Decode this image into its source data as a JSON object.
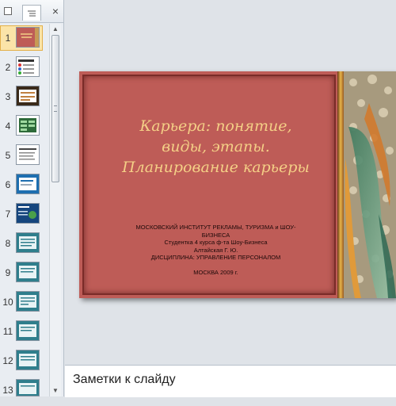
{
  "panel": {
    "tabs": [
      "outline-tab",
      "slides-tab"
    ],
    "close_icon": "×",
    "thumbnails": [
      {
        "num": "1",
        "selected": true
      },
      {
        "num": "2"
      },
      {
        "num": "3"
      },
      {
        "num": "4"
      },
      {
        "num": "5"
      },
      {
        "num": "6"
      },
      {
        "num": "7"
      },
      {
        "num": "8"
      },
      {
        "num": "9"
      },
      {
        "num": "10"
      },
      {
        "num": "11"
      },
      {
        "num": "12"
      },
      {
        "num": "13"
      }
    ]
  },
  "slide": {
    "title_line1": "Карьера: понятие,",
    "title_line2": "виды, этапы.",
    "title_line3": "Планирование карьеры",
    "sub_line1": "МОСКОВСКИЙ ИНСТИТУТ РЕКЛАМЫ, ТУРИЗМА и ШОУ-",
    "sub_line2": "БИЗНЕСА",
    "sub_line3": "Студентка  4 курса  ф-та Шоу-Бизнеса",
    "sub_line4": "Алтайская  Г. Ю.",
    "sub_line5": "ДИСЦИПЛИНА:  УПРАВЛЕНИЕ   ПЕРСОНАЛОМ",
    "sub_line6": "МОСКВА  2009  г."
  },
  "notes": {
    "placeholder": "Заметки к слайду"
  },
  "colors": {
    "slide_bg": "#be5c57",
    "title": "#f4cf86",
    "selection": "#fbe4a8"
  }
}
